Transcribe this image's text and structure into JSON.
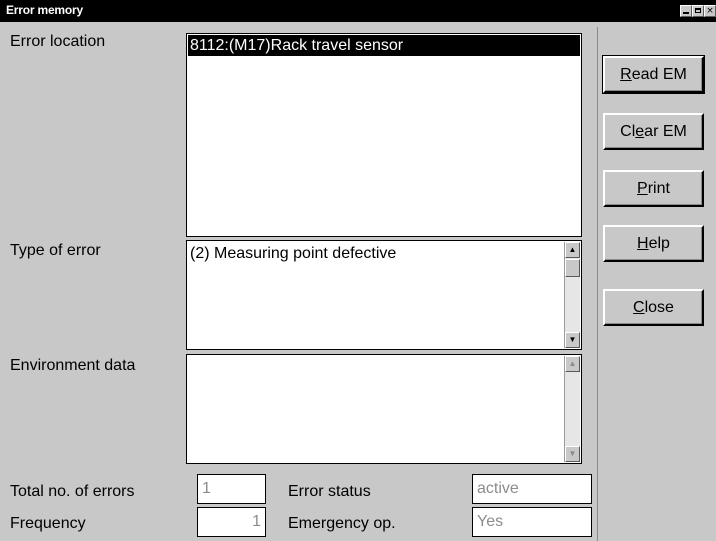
{
  "window": {
    "title": "Error memory"
  },
  "labels": {
    "error_location": "Error location",
    "type_of_error": "Type of error",
    "environment_data": "Environment data",
    "total_errors": "Total no. of errors",
    "frequency": "Frequency",
    "error_status": "Error status",
    "emergency_op": "Emergency op."
  },
  "error_location": {
    "selected_item": "8112:(M17)Rack travel sensor"
  },
  "type_of_error": {
    "value": "(2) Measuring point defective"
  },
  "environment_data": {
    "value": ""
  },
  "fields": {
    "total_errors": "1",
    "frequency": "1",
    "error_status": "active",
    "emergency_op": "Yes"
  },
  "buttons": [
    {
      "pre": "",
      "mnemonic": "R",
      "post": "ead EM"
    },
    {
      "pre": "Cl",
      "mnemonic": "e",
      "post": "ar EM"
    },
    {
      "pre": "",
      "mnemonic": "P",
      "post": "rint"
    },
    {
      "pre": "",
      "mnemonic": "H",
      "post": "elp"
    },
    {
      "pre": "",
      "mnemonic": "C",
      "post": "lose"
    }
  ]
}
